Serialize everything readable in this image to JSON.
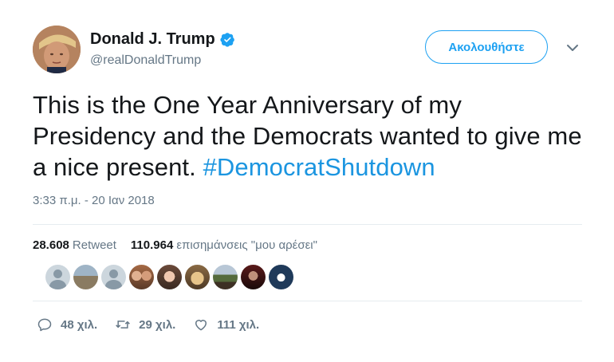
{
  "user": {
    "name": "Donald J. Trump",
    "handle": "@realDonaldTrump",
    "verified": true
  },
  "follow_label": "Ακολουθήστε",
  "tweet": {
    "text": "This is the One Year Anniversary of my Presidency and the Democrats wanted to give me a nice present. ",
    "hashtag": "#DemocratShutdown",
    "timestamp": "3:33 π.μ. - 20 Ιαν 2018"
  },
  "stats": {
    "retweets_count": "28.608",
    "retweets_label": "Retweet",
    "likes_count": "110.964",
    "likes_label": "επισημάνσεις \"μου αρέσει\""
  },
  "actions": {
    "replies": "48 χιλ.",
    "retweets": "29 χιλ.",
    "likes": "111 χιλ."
  },
  "colors": {
    "accent": "#1da1f2",
    "hashtag": "#1b95e0",
    "muted": "#657786",
    "text": "#14171a"
  },
  "icons": [
    "verified-icon",
    "chevron-down-icon",
    "reply-icon",
    "retweet-icon",
    "like-icon"
  ]
}
